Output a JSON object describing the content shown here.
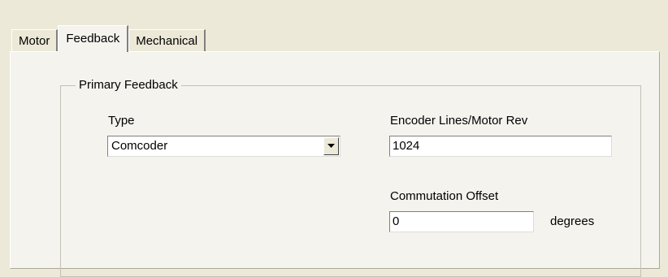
{
  "tabs": [
    {
      "label": "Motor",
      "active": false
    },
    {
      "label": "Feedback",
      "active": true
    },
    {
      "label": "Mechanical",
      "active": false
    }
  ],
  "primary_feedback": {
    "title": "Primary Feedback",
    "type": {
      "label": "Type",
      "selected": "Comcoder"
    },
    "encoder_lines": {
      "label": "Encoder Lines/Motor Rev",
      "value": "1024"
    },
    "commutation_offset": {
      "label": "Commutation Offset",
      "value": "0",
      "unit": "degrees"
    }
  },
  "icons": {
    "dropdown": "chevron-down-icon"
  }
}
